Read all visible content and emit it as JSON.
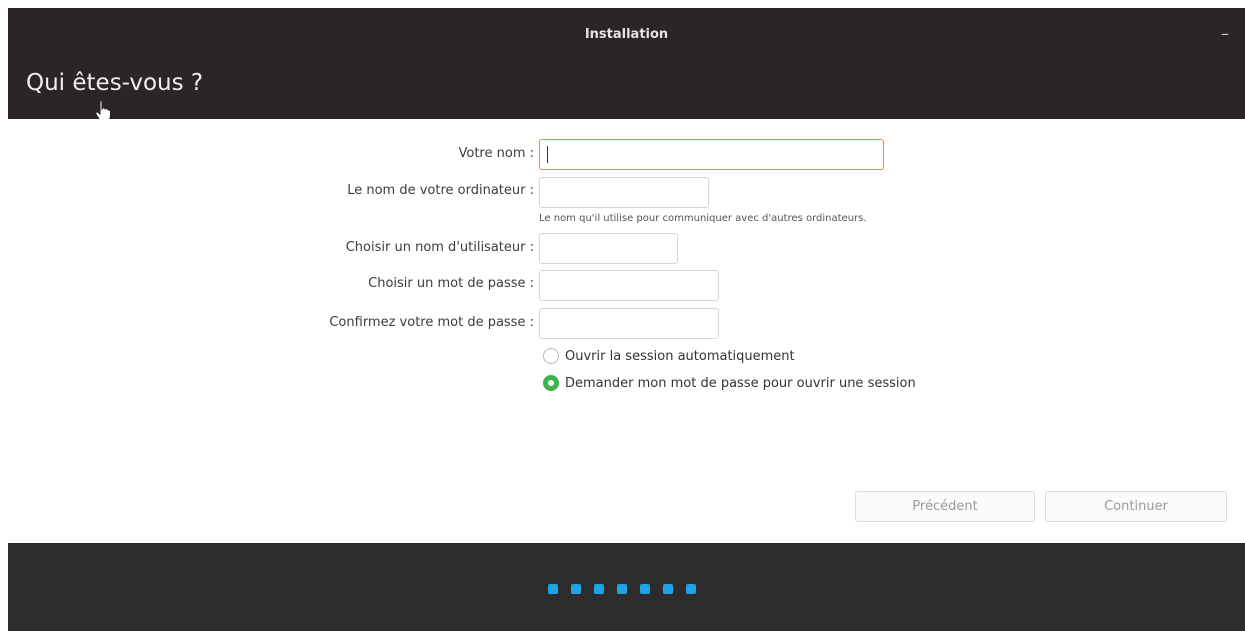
{
  "window": {
    "title": "Installation",
    "minimize_glyph": "–"
  },
  "page": {
    "heading": "Qui êtes-vous ?"
  },
  "form": {
    "name_label": "Votre nom :",
    "name_value": "",
    "computer_label": "Le nom de votre ordinateur :",
    "computer_value": "",
    "computer_hint": "Le nom qu'il utilise pour communiquer avec d'autres ordinateurs.",
    "username_label": "Choisir un nom d'utilisateur :",
    "username_value": "",
    "password_label": "Choisir un mot de passe :",
    "password_value": "",
    "confirm_label": "Confirmez votre mot de passe :",
    "confirm_value": ""
  },
  "login_options": [
    {
      "label": "Ouvrir la session automatiquement",
      "checked": false
    },
    {
      "label": "Demander mon mot de passe pour ouvrir une session",
      "checked": true
    }
  ],
  "buttons": {
    "previous": "Précédent",
    "continue": "Continuer"
  },
  "progress": {
    "steps_total": 7,
    "accent_color": "#1fa3e6"
  },
  "colors": {
    "titlebar": "#2c2528",
    "focus_border": "#e9865c",
    "radio_checked": "#3fb34f"
  },
  "icons": {
    "cursor": "hand-pointer-icon"
  }
}
